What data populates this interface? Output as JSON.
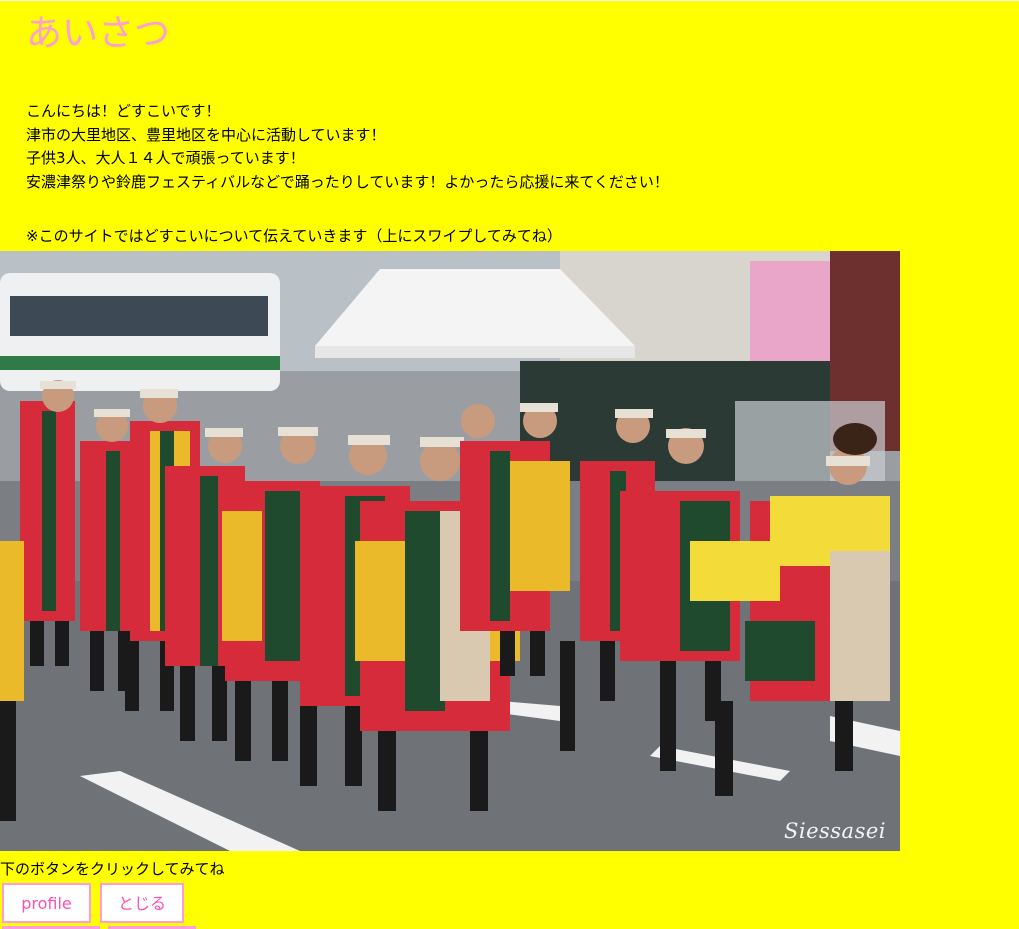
{
  "heading": "あいさつ",
  "intro_lines": [
    "こんにちは！どすこいです！",
    "津市の大里地区、豊里地区を中心に活動しています！",
    "子供3人、大人１４人で頑張っています！",
    "安濃津祭りや鈴鹿フェスティバルなどで踊ったりしています！よかったら応援に来てください！"
  ],
  "note": "※このサイトではどすこいについて伝えていきます（上にスワイプしてみてね）",
  "photo": {
    "watermark": "Siessasei"
  },
  "click_prompt": "下のボタンをクリックしてみてね",
  "buttons": {
    "profile": "profile",
    "close": "とじる"
  },
  "colors": {
    "background": "#ffff00",
    "heading": "#ff9cdc",
    "button_text": "#ff4fb0",
    "button_border": "#ff9cdc"
  }
}
